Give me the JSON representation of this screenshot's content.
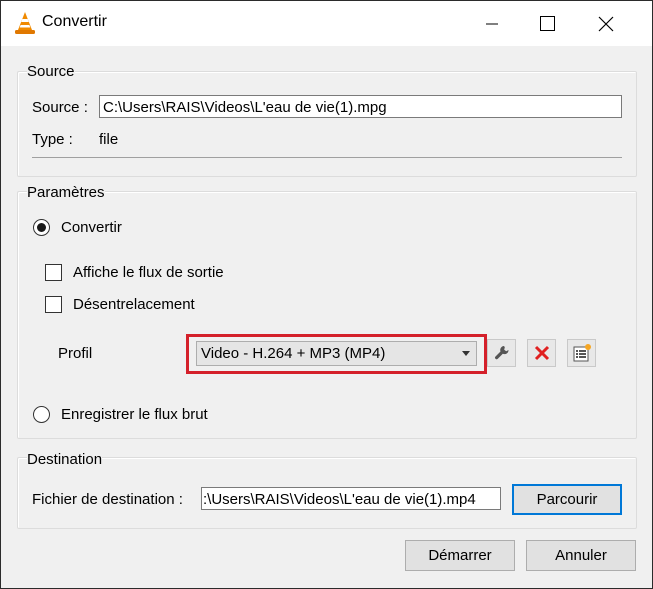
{
  "window": {
    "title": "Convertir",
    "controls": {
      "minimize": "minimize-icon",
      "maximize": "maximize-icon",
      "close": "close-icon"
    }
  },
  "source_group": {
    "title": "Source",
    "source_label": "Source :",
    "source_value": "C:\\Users\\RAIS\\Videos\\L'eau de vie(1).mpg",
    "type_label": "Type :",
    "type_value": "file"
  },
  "params_group": {
    "title": "Paramètres",
    "convert_radio": {
      "label": "Convertir",
      "checked": true
    },
    "show_output_checkbox": {
      "label": "Affiche le flux de sortie",
      "checked": false
    },
    "deinterlace_checkbox": {
      "label": "Désentrelacement",
      "checked": false
    },
    "profile_label": "Profil",
    "profile_selected": "Video - H.264 + MP3 (MP4)",
    "profile_buttons": [
      "wrench-icon",
      "delete-icon",
      "new-profile-icon"
    ],
    "raw_dump_radio": {
      "label": "Enregistrer le flux brut",
      "checked": false
    }
  },
  "destination_group": {
    "title": "Destination",
    "file_label": "Fichier de destination :",
    "file_value": ":\\Users\\RAIS\\Videos\\L'eau de vie(1).mp4",
    "browse_button": "Parcourir"
  },
  "footer": {
    "start_button": "Démarrer",
    "cancel_button": "Annuler"
  },
  "colors": {
    "highlight": "#d4202a",
    "focus": "#0078d7",
    "delete_icon": "#e02020"
  }
}
